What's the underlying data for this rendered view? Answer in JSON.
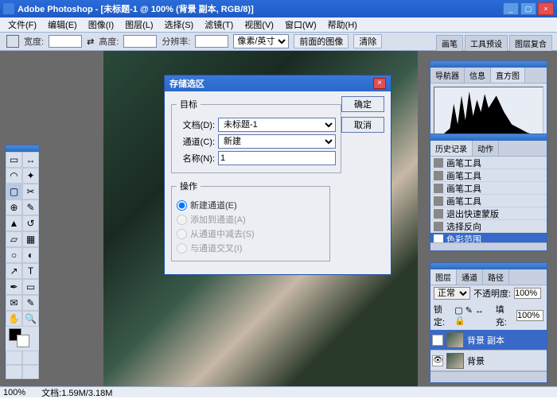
{
  "app": {
    "title": "Adobe Photoshop - [未标题-1 @ 100% (背景 副本, RGB/8)]"
  },
  "menu": [
    "文件(F)",
    "编辑(E)",
    "图像(I)",
    "图层(L)",
    "选择(S)",
    "滤镜(T)",
    "视图(V)",
    "窗口(W)",
    "帮助(H)"
  ],
  "options": {
    "width_lbl": "宽度:",
    "height_lbl": "高度:",
    "res_lbl": "分辨率:",
    "unit": "像素/英寸",
    "front_btn": "前面的图像",
    "clear_btn": "清除"
  },
  "righttabs": [
    "画笔",
    "工具预设",
    "图层复合"
  ],
  "histogram_tabs": [
    "导航器",
    "信息",
    "直方图"
  ],
  "history": {
    "tabs": [
      "历史记录",
      "动作"
    ],
    "items": [
      "画笔工具",
      "画笔工具",
      "画笔工具",
      "画笔工具",
      "退出快速蒙版",
      "选择反向",
      "色彩范围"
    ]
  },
  "layers": {
    "tabs": [
      "图层",
      "通道",
      "路径"
    ],
    "blend": "正常",
    "opacity_lbl": "不透明度:",
    "opacity": "100%",
    "lock_lbl": "锁定:",
    "fill_lbl": "填充:",
    "fill": "100%",
    "items": [
      {
        "name": "背景 副本"
      },
      {
        "name": "背景"
      }
    ]
  },
  "dialog": {
    "title": "存储选区",
    "ok": "确定",
    "cancel": "取消",
    "dest_legend": "目标",
    "doc_lbl": "文档(D):",
    "doc_val": "未标题-1",
    "chan_lbl": "通道(C):",
    "chan_val": "新建",
    "name_lbl": "名称(N):",
    "name_val": "1",
    "op_legend": "操作",
    "op1": "新建通道(E)",
    "op2": "添加到通道(A)",
    "op3": "从通道中减去(S)",
    "op4": "与通道交叉(I)"
  },
  "status": {
    "zoom": "100%",
    "doc": "文档:1.59M/3.18M"
  }
}
